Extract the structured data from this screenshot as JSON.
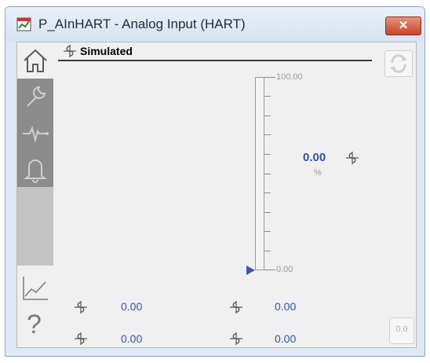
{
  "window": {
    "title": "P_AInHART - Analog Input (HART)",
    "close_glyph": "✕"
  },
  "nav": {
    "tabs": [
      {
        "icon": "home-icon",
        "active": true
      },
      {
        "icon": "wrench-icon",
        "active": false
      },
      {
        "icon": "trend-pulse-icon",
        "active": false
      },
      {
        "icon": "bell-icon",
        "active": false
      }
    ],
    "bottom": [
      {
        "icon": "trend-chart-icon"
      },
      {
        "icon": "help-icon",
        "label": "?"
      }
    ]
  },
  "header": {
    "status_label": "Simulated",
    "status_icon": "simulation-icon"
  },
  "bar": {
    "max_label": "100.00",
    "min_label": "0.00",
    "fill_fraction": 0.0,
    "color": "#4a63b3"
  },
  "pv": {
    "value": "0.00",
    "units": "%"
  },
  "readouts": {
    "row1_left": "0.00",
    "row1_right": "0.00",
    "row2_left": "0.00",
    "row2_right": "0.00"
  },
  "buttons": {
    "small_label": "0.0"
  },
  "colors": {
    "value_text": "#3450a8",
    "close_button": "#c7432a"
  }
}
